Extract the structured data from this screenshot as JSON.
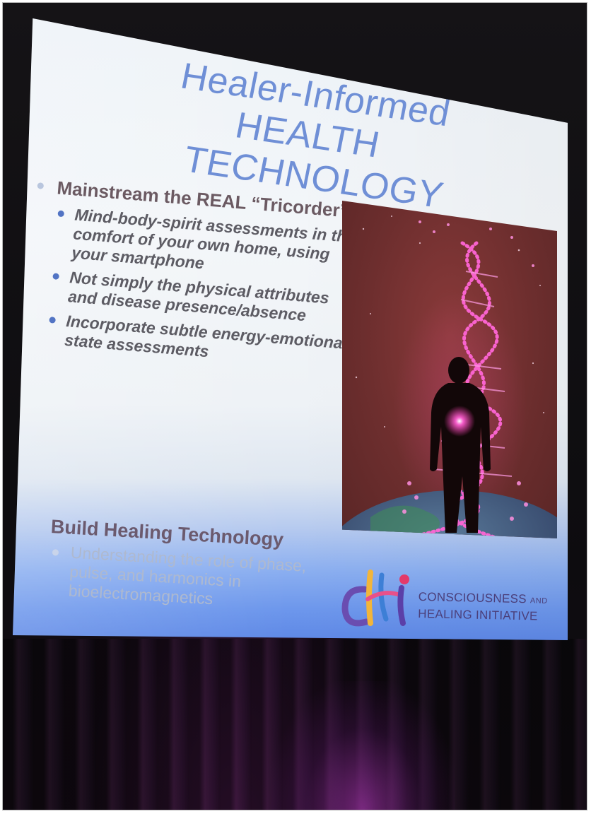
{
  "slide": {
    "title_line1": "Healer-Informed HEALTH",
    "title_line2": "TECHNOLOGY",
    "bullet_main": "Mainstream the REAL “Tricorder”",
    "sub_bullets": [
      "Mind-body-spirit assessments in the comfort of your own home, using your smartphone",
      "Not simply the physical attributes and disease presence/absence",
      "Incorporate subtle energy-emotional state assessments"
    ],
    "section_heading": "Build Healing Technology",
    "section_bullet": "Understanding the role of phase, pulse, and harmonics in bioelectromagnetics"
  },
  "logo": {
    "mark_text": "chi",
    "org_line1": "CONSCIOUSNESS",
    "org_line1_suffix": "AND",
    "org_line2": "HEALING INITIATIVE"
  },
  "colors": {
    "title": "#6f8fd6",
    "bullet_dot": "#5274c4",
    "dna_pink": "#ff5fd2",
    "picture_background": "#6d2e2e"
  }
}
